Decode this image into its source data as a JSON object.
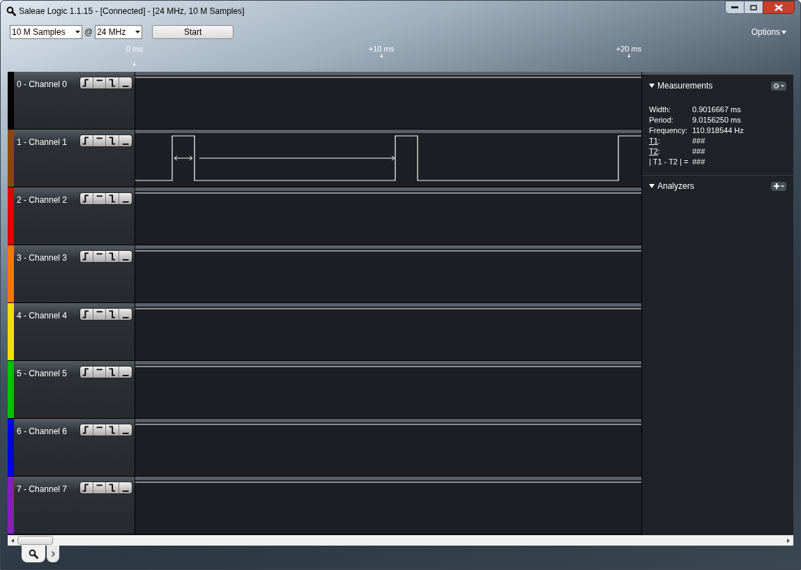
{
  "window": {
    "title": "Saleae Logic 1.1.15 - [Connected] - [24 MHz, 10 M Samples]"
  },
  "toolbar": {
    "samples": "10 M Samples",
    "at": "@",
    "rate": "24 MHz",
    "start": "Start",
    "options": "Options"
  },
  "ruler": [
    "0 ms",
    "+10 ms",
    "+20 ms"
  ],
  "channels": [
    {
      "label": "0 - Channel 0",
      "color": "#000000",
      "kind": "flat"
    },
    {
      "label": "1 - Channel 1",
      "color": "#8b4513",
      "kind": "pulses"
    },
    {
      "label": "2 - Channel 2",
      "color": "#e00000",
      "kind": "flat"
    },
    {
      "label": "3 - Channel 3",
      "color": "#f07800",
      "kind": "flat"
    },
    {
      "label": "4 - Channel 4",
      "color": "#f0e000",
      "kind": "flat"
    },
    {
      "label": "5 - Channel 5",
      "color": "#00c000",
      "kind": "flat"
    },
    {
      "label": "6 - Channel 6",
      "color": "#0000e0",
      "kind": "flat"
    },
    {
      "label": "7 - Channel 7",
      "color": "#8020c0",
      "kind": "flat"
    }
  ],
  "measurements": {
    "title": "Measurements",
    "expanded": true,
    "rows": [
      {
        "label": "Width:",
        "value": "0.9016667 ms",
        "kind": "plain"
      },
      {
        "label": "Period:",
        "value": "9.0156250 ms",
        "kind": "plain"
      },
      {
        "label": "Frequency:",
        "value": "110.918544 Hz",
        "kind": "plain"
      },
      {
        "label": "T1",
        "suffix": ":",
        "value": "###",
        "kind": "link"
      },
      {
        "label": "T2",
        "suffix": ":",
        "value": "###",
        "kind": "link"
      },
      {
        "label": "| T1 - T2 | =",
        "value": "###",
        "kind": "plain"
      }
    ]
  },
  "analyzers": {
    "title": "Analyzers",
    "expanded": true
  }
}
